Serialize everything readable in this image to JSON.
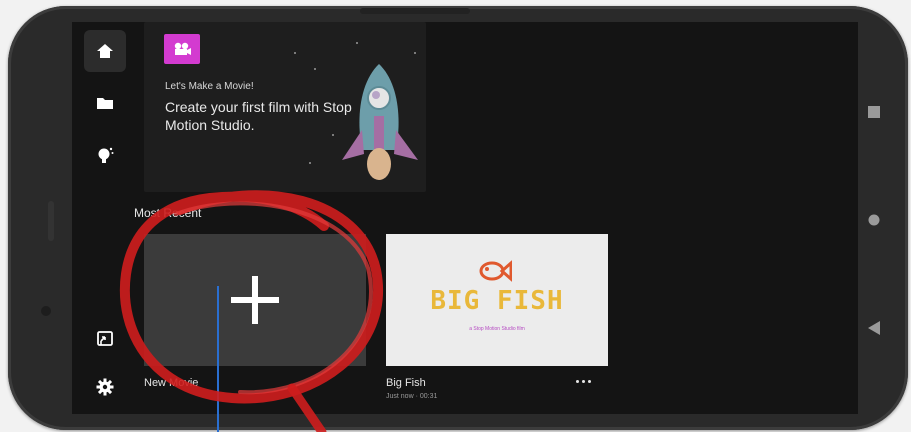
{
  "nav_rail": {
    "items": [
      {
        "name": "home",
        "icon": "home-icon",
        "active": true
      },
      {
        "name": "projects",
        "icon": "folder-icon",
        "active": false
      },
      {
        "name": "ideas",
        "icon": "lightbulb-icon",
        "active": false
      }
    ],
    "bottom": [
      {
        "name": "cast",
        "icon": "cast-icon"
      },
      {
        "name": "settings",
        "icon": "gear-icon"
      }
    ]
  },
  "banner": {
    "small_label": "Let's Make a Movie!",
    "title": "Create your first film with Stop Motion Studio.",
    "logo_icon": "film-reel-icon",
    "art_icon": "rocket-icon",
    "logo_color": "#d33bd0"
  },
  "section": {
    "title": "Most Recent"
  },
  "movies": [
    {
      "label": "New Movie",
      "icon": "plus-icon"
    },
    {
      "label": "Big Fish",
      "meta": "Just now · 00:31",
      "thumb_title": "BIG FISH",
      "thumb_subtitle": "a Stop Motion Studio film",
      "thumb_color": "#e9b83a"
    }
  ],
  "android_nav": [
    {
      "name": "recents",
      "icon": "square-icon"
    },
    {
      "name": "home",
      "icon": "circle-icon"
    },
    {
      "name": "back",
      "icon": "triangle-back-icon"
    }
  ],
  "annotation": {
    "color": "#d31d1d"
  }
}
